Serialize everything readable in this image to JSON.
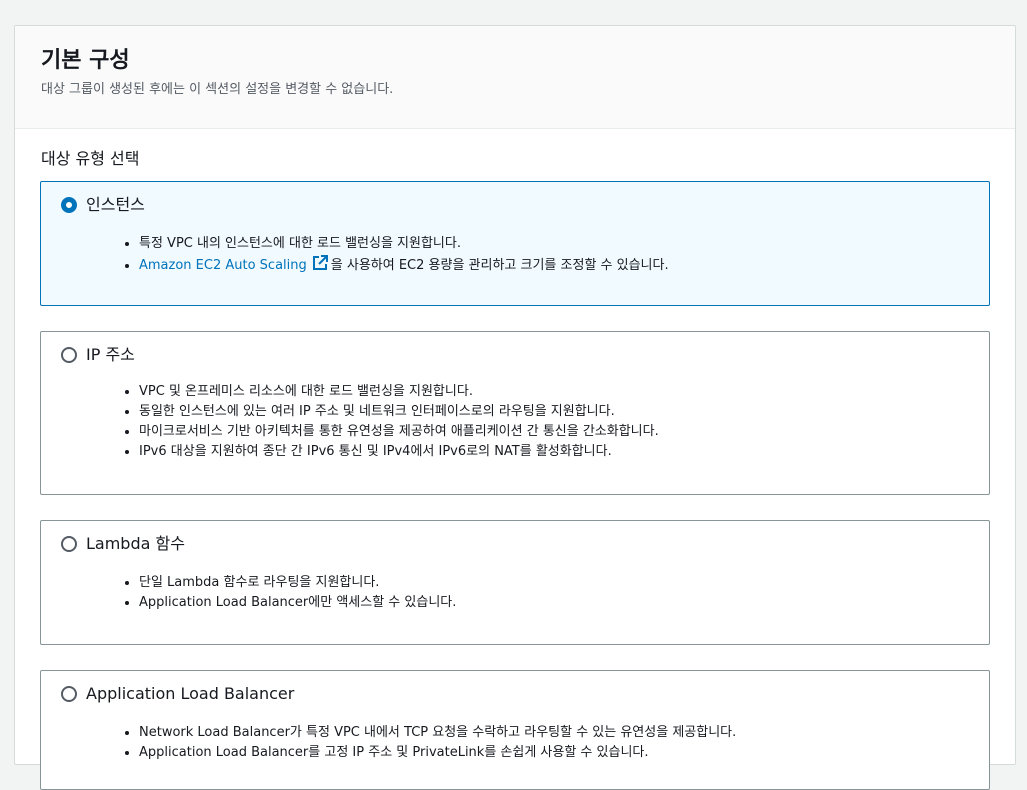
{
  "header": {
    "title": "기본 구성",
    "description": "대상 그룹이 생성된 후에는 이 섹션의 설정을 변경할 수 없습니다."
  },
  "target_type": {
    "label": "대상 유형 선택",
    "options": [
      {
        "title": "인스턴스",
        "selected": true,
        "bullets": [
          "특정 VPC 내의 인스턴스에 대한 로드 밸런싱을 지원합니다."
        ],
        "link_text": "Amazon EC2 Auto Scaling",
        "link_suffix": "을 사용하여 EC2 용량을 관리하고 크기를 조정할 수 있습니다."
      },
      {
        "title": "IP 주소",
        "selected": false,
        "bullets": [
          "VPC 및 온프레미스 리소스에 대한 로드 밸런싱을 지원합니다.",
          "동일한 인스턴스에 있는 여러 IP 주소 및 네트워크 인터페이스로의 라우팅을 지원합니다.",
          "마이크로서비스 기반 아키텍처를 통한 유연성을 제공하여 애플리케이션 간 통신을 간소화합니다.",
          "IPv6 대상을 지원하여 종단 간 IPv6 통신 및 IPv4에서 IPv6로의 NAT를 활성화합니다."
        ]
      },
      {
        "title": "Lambda 함수",
        "selected": false,
        "bullets": [
          "단일 Lambda 함수로 라우팅을 지원합니다.",
          "Application Load Balancer에만 액세스할 수 있습니다."
        ]
      },
      {
        "title": "Application Load Balancer",
        "selected": false,
        "bullets": [
          "Network Load Balancer가 특정 VPC 내에서 TCP 요청을 수락하고 라우팅할 수 있는 유연성을 제공합니다.",
          "Application Load Balancer를 고정 IP 주소 및 PrivateLink를 손쉽게 사용할 수 있습니다."
        ]
      }
    ]
  },
  "colors": {
    "accent": "#0073bb",
    "selected_bg": "#f1faff",
    "border": "#879596"
  }
}
